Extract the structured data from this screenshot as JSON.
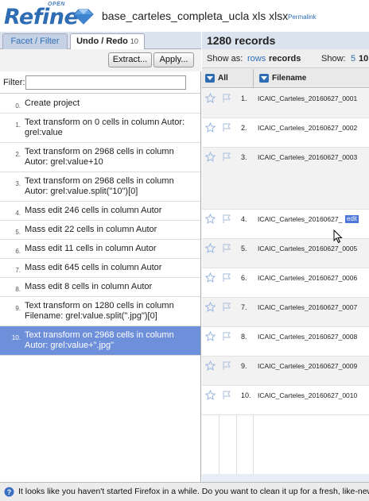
{
  "app": {
    "logo_small": "OPEN",
    "logo_text": "Refine",
    "project_name": "base_carteles_completa_ucla xls xlsx",
    "permalink": "Permalink"
  },
  "left_tabs": {
    "facet": "Facet / Filter",
    "undo": "Undo / Redo",
    "undo_count": "10"
  },
  "undo_toolbar": {
    "extract": "Extract...",
    "apply": "Apply..."
  },
  "filter": {
    "label": "Filter:",
    "value": ""
  },
  "history": [
    {
      "num": "0.",
      "text": "Create project"
    },
    {
      "num": "1.",
      "text": "Text transform on 0 cells in column Autor: grel:value"
    },
    {
      "num": "2.",
      "text": "Text transform on 2968 cells in column Autor: grel:value+10"
    },
    {
      "num": "3.",
      "text": "Text transform on 2968 cells in column Autor: grel:value.split(\"10\")[0]"
    },
    {
      "num": "4.",
      "text": "Mass edit 246 cells in column Autor"
    },
    {
      "num": "5.",
      "text": "Mass edit 22 cells in column Autor"
    },
    {
      "num": "6.",
      "text": "Mass edit 11 cells in column Autor"
    },
    {
      "num": "7.",
      "text": "Mass edit 645 cells in column Autor"
    },
    {
      "num": "8.",
      "text": "Mass edit 8 cells in column Autor"
    },
    {
      "num": "9.",
      "text": "Text transform on 1280 cells in column Filename: grel:value.split(\".jpg\")[0]"
    },
    {
      "num": "10.",
      "text": "Text transform on 2968 cells in column Autor: grel:value+\".jpg\""
    }
  ],
  "selected_history": 10,
  "records": {
    "title": "1280 records",
    "show_as": "Show as:",
    "rows_link": "rows",
    "records_mode": "records",
    "show_label": "Show:",
    "show_5": "5",
    "show_10": "10"
  },
  "grid": {
    "col_all": "All",
    "col_filename": "Filename",
    "rows": [
      {
        "num": "1.",
        "filename": "ICAIC_Carteles_20160627_0001"
      },
      {
        "num": "2.",
        "filename": "ICAIC_Carteles_20160627_0002"
      },
      {
        "num": "3.",
        "filename": "ICAIC_Carteles_20160627_0003"
      },
      {
        "num": "4.",
        "filename": "ICAIC_Carteles_20160627_",
        "edit": "edit"
      },
      {
        "num": "5.",
        "filename": "ICAIC_Carteles_20160627_0005"
      },
      {
        "num": "6.",
        "filename": "ICAIC_Carteles_20160627_0006"
      },
      {
        "num": "7.",
        "filename": "ICAIC_Carteles_20160627_0007"
      },
      {
        "num": "8.",
        "filename": "ICAIC_Carteles_20160627_0008"
      },
      {
        "num": "9.",
        "filename": "ICAIC_Carteles_20160627_0009"
      },
      {
        "num": "10.",
        "filename": "ICAIC_Carteles_20160627_0010"
      }
    ]
  },
  "notification": {
    "text": "It looks like you haven't started Firefox in a while. Do you want to clean it up for a fresh, like-new exp"
  },
  "colors": {
    "accent": "#2e6db4",
    "selected_history_bg": "#6e8fd9"
  },
  "icons": [
    "diamond-logo-icon",
    "star-icon",
    "flag-icon",
    "dropdown-arrow-icon",
    "help-icon",
    "mouse-cursor-icon"
  ]
}
